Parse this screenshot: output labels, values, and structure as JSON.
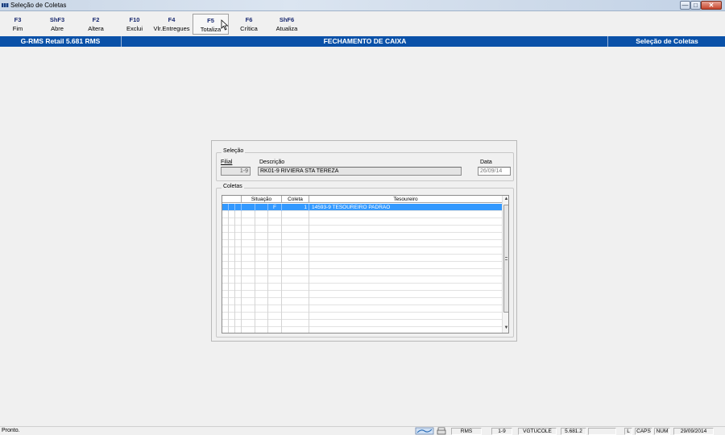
{
  "window": {
    "title": "Seleção de Coletas",
    "icon": "app-icon",
    "controls": {
      "minimize": "minimize-icon",
      "maximize": "maximize-icon",
      "close": "close-icon"
    }
  },
  "toolbar": {
    "buttons": [
      {
        "key": "F3",
        "label": "Fim"
      },
      {
        "key": "ShF3",
        "label": "Abre"
      },
      {
        "key": "F2",
        "label": "Altera"
      },
      {
        "key": "F10",
        "label": "Exclui"
      },
      {
        "key": "F4",
        "label": "Vlr.Entregues"
      },
      {
        "key": "F5",
        "label": "Totaliza"
      },
      {
        "key": "F6",
        "label": "Crítica"
      },
      {
        "key": "ShF6",
        "label": "Atualiza"
      }
    ]
  },
  "header": {
    "app": "G-RMS Retail 5.681 RMS",
    "module": "FECHAMENTO DE CAIXA",
    "screen": "Seleção de Coletas"
  },
  "selecao": {
    "legend": "Seleção",
    "filial_label": "Filial",
    "filial_value": "1-9",
    "descricao_label": "Descrição",
    "descricao_value": "RK01-9 RIVIERA STA TEREZA",
    "data_label": "Data",
    "data_value": "26/09/14"
  },
  "coletas": {
    "legend": "Coletas",
    "columns": [
      "Situação",
      "Coleta",
      "Tesoureiro"
    ],
    "rows": [
      {
        "situacao": "F",
        "coleta": "1",
        "tesoureiro": "14593-9 TESOUREIRO PADRAO"
      }
    ]
  },
  "statusbar": {
    "message": "Pronto.",
    "panes": [
      "RMS",
      "1-9",
      "VGTUCOLE",
      "5.681.2",
      "",
      "L",
      "CAPS",
      "NUM",
      "29/09/2014"
    ]
  },
  "colors": {
    "header_bg": "#0a51a8",
    "selection_bg": "#3399ff"
  }
}
